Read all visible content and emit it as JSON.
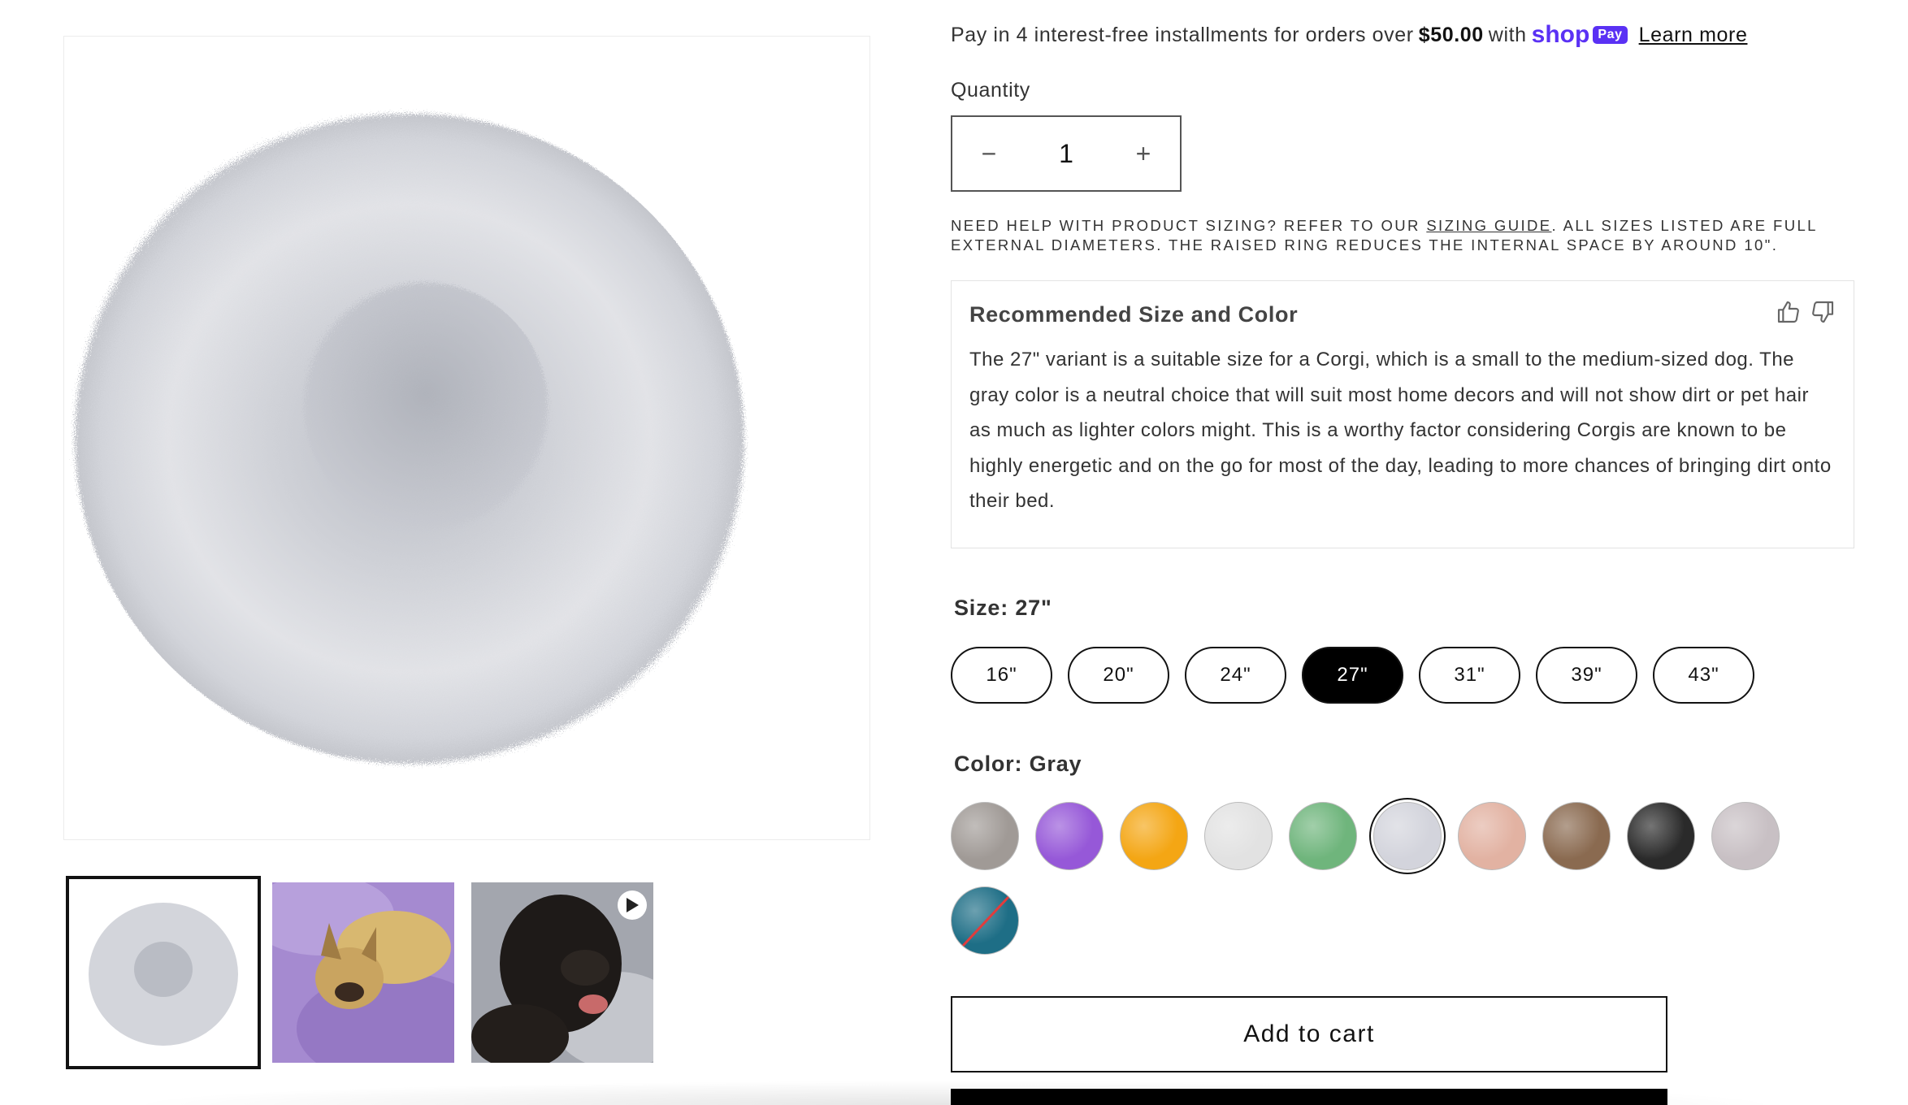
{
  "shop_pay": {
    "prefix": "Pay in 4 interest-free installments for orders over",
    "amount": "$50.00",
    "suffix": "with",
    "logo_text": "shop",
    "badge_text": "Pay",
    "learn_more": "Learn more",
    "brand_color": "#5a31f4"
  },
  "quantity": {
    "label": "Quantity",
    "value": "1",
    "minus": "−",
    "plus": "+"
  },
  "sizing_note": {
    "before": "NEED HELP WITH PRODUCT SIZING? REFER TO OUR",
    "link": "SIZING GUIDE",
    "after": ". ALL SIZES LISTED ARE FULL EXTERNAL DIAMETERS. THE RAISED RING REDUCES THE INTERNAL SPACE BY AROUND 10\"."
  },
  "recommendation": {
    "title": "Recommended Size and Color",
    "body": "The 27\" variant is a suitable size for a Corgi, which is a small to the medium-sized dog. The gray color is a neutral choice that will suit most home decors and will not show dirt or pet hair as much as lighter colors might. This is a worthy factor considering Corgis are known to be highly energetic and on the go for most of the day, leading to more chances of bringing dirt onto their bed.",
    "icons": [
      "thumbs-up-icon",
      "thumbs-down-icon"
    ]
  },
  "size": {
    "label": "Size: 27\"",
    "options": [
      "16\"",
      "20\"",
      "24\"",
      "27\"",
      "31\"",
      "39\"",
      "43\""
    ],
    "selected": "27\""
  },
  "color": {
    "label": "Color: Gray",
    "selected": "Gray",
    "swatches": [
      {
        "color": "#a09a96",
        "selected": false,
        "unavailable": false
      },
      {
        "color": "#9658d8",
        "selected": false,
        "unavailable": false
      },
      {
        "color": "#f4a614",
        "selected": false,
        "unavailable": false
      },
      {
        "color": "#e2e2e2",
        "selected": false,
        "unavailable": false
      },
      {
        "color": "#6fb57c",
        "selected": false,
        "unavailable": false
      },
      {
        "color": "#d3d4dc",
        "selected": true,
        "unavailable": false
      },
      {
        "color": "#e2b2a2",
        "selected": false,
        "unavailable": false
      },
      {
        "color": "#8a6a50",
        "selected": false,
        "unavailable": false
      },
      {
        "color": "#2a2a2a",
        "selected": false,
        "unavailable": false
      },
      {
        "color": "#c8c0c4",
        "selected": false,
        "unavailable": false
      },
      {
        "color": "#1e6e86",
        "selected": false,
        "unavailable": true
      }
    ]
  },
  "actions": {
    "add_to_cart": "Add to cart"
  },
  "media": {
    "main_image": "gray-donut-bed-image",
    "thumbnails": [
      {
        "name": "gray-donut-bed-thumbnail",
        "selected": true,
        "video": false
      },
      {
        "name": "french-bulldog-on-purple-bed-thumbnail",
        "selected": false,
        "video": false
      },
      {
        "name": "black-dog-on-gray-bed-video-thumbnail",
        "selected": false,
        "video": true
      }
    ]
  }
}
